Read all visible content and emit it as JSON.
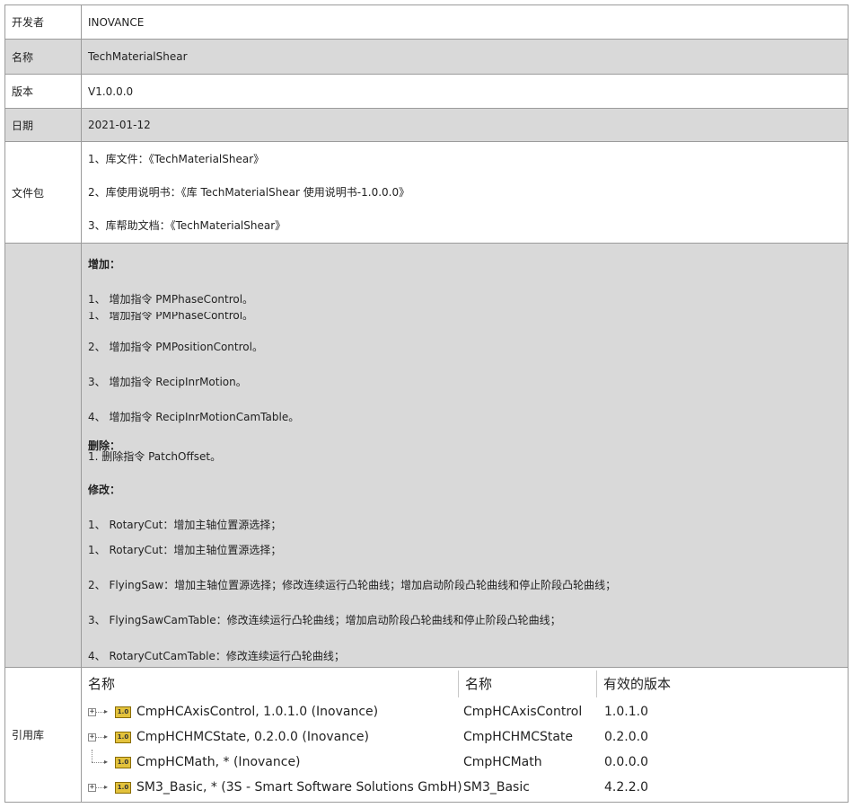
{
  "rows": {
    "developer": {
      "label": "开发者",
      "value": "INOVANCE"
    },
    "name": {
      "label": "名称",
      "value": "TechMaterialShear"
    },
    "version": {
      "label": "版本",
      "value": "V1.0.0.0"
    },
    "date": {
      "label": "日期",
      "value": "2021-01-12"
    },
    "package": {
      "label": "文件包",
      "lines": [
        "1、库文件：《TechMaterialShear》",
        "2、库使用说明书：《库 TechMaterialShear 使用说明书-1.0.0.0》",
        "3、库帮助文档：《TechMaterialShear》"
      ]
    },
    "changes": {
      "add_title": "增加：",
      "add_lines": [
        "1、 增加指令 PMPhaseControl。",
        "1、 增加指令 PMPhaseControl。",
        "2、 增加指令 PMPositionControl。",
        "3、 增加指令 RecipInrMotion。",
        "4、 增加指令 RecipInrMotionCamTable。"
      ],
      "del_title": "删除：",
      "del_line": "1. 删除指令 PatchOffset。",
      "mod_title": "修改：",
      "mod_lines": [
        "1、 RotaryCut：增加主轴位置源选择；",
        "1、 RotaryCut：增加主轴位置源选择；",
        "2、 FlyingSaw：增加主轴位置源选择；修改连续运行凸轮曲线；增加启动阶段凸轮曲线和停止阶段凸轮曲线；",
        "3、 FlyingSawCamTable：修改连续运行凸轮曲线；增加启动阶段凸轮曲线和停止阶段凸轮曲线；",
        "4、 RotaryCutCamTable：修改连续运行凸轮曲线；"
      ]
    },
    "refs": {
      "label": "引用库",
      "headers": [
        "名称",
        "名称",
        "有效的版本"
      ],
      "icon_text": "1.0",
      "items": [
        {
          "full": "CmpHCAxisControl, 1.0.1.0 (Inovance)",
          "name": "CmpHCAxisControl",
          "version": "1.0.1.0",
          "expandable": true
        },
        {
          "full": "CmpHCHMCState, 0.2.0.0 (Inovance)",
          "name": "CmpHCHMCState",
          "version": "0.2.0.0",
          "expandable": true
        },
        {
          "full": "CmpHCMath, * (Inovance)",
          "name": "CmpHCMath",
          "version": "0.0.0.0",
          "expandable": false
        },
        {
          "full": "SM3_Basic, * (3S - Smart Software Solutions GmbH)",
          "name": "SM3_Basic",
          "version": "4.2.2.0",
          "expandable": true
        }
      ],
      "expander_symbol": "+"
    }
  }
}
